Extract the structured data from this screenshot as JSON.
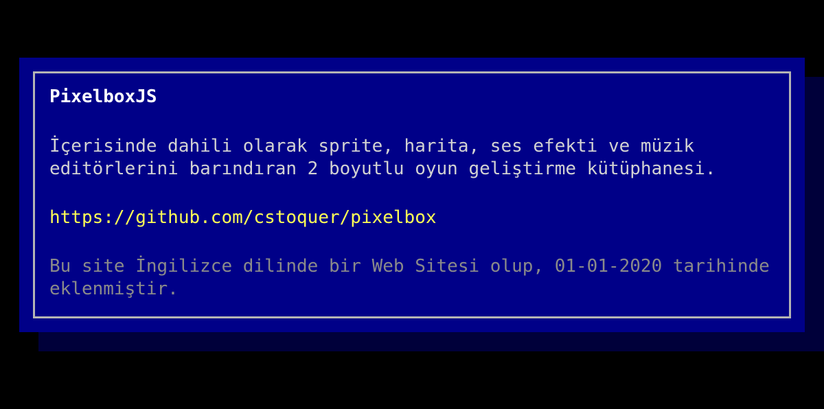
{
  "dialog": {
    "title": "PixelboxJS",
    "description": "İçerisinde dahili olarak sprite, harita, ses efekti ve müzik editörlerini barındıran 2 boyutlu oyun geliştirme kütüphanesi.",
    "link": "https://github.com/cstoquer/pixelbox",
    "meta": "Bu site İngilizce dilinde bir Web Sitesi olup, 01-01-2020 tarihinde eklenmiştir."
  },
  "colors": {
    "background": "#000000",
    "dialog_bg": "#000088",
    "border": "#b4b4b4",
    "title": "#ffffff",
    "text": "#d2d2d2",
    "link": "#ffff55",
    "meta": "#8a8a8a"
  }
}
